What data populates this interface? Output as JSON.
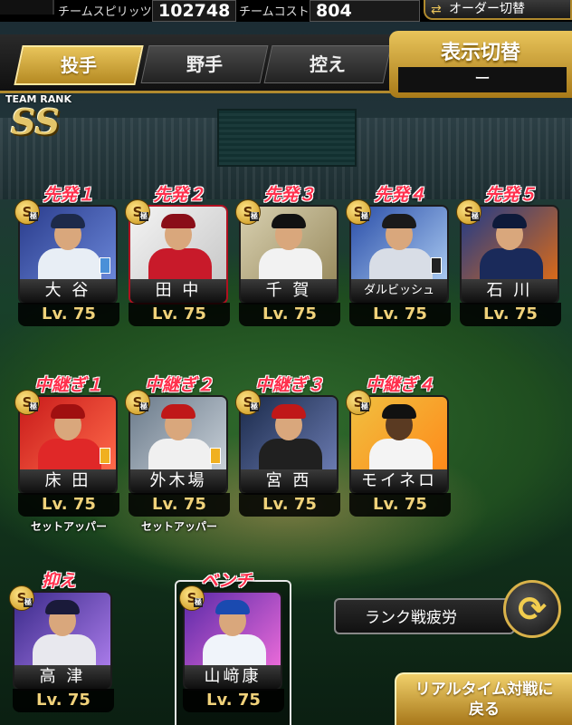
{
  "header": {
    "spirit_label": "チームスピリッツ",
    "spirit_value": "102748",
    "cost_label": "チームコスト",
    "cost_value": "804",
    "order_button": "オーダー切替"
  },
  "tabs": [
    {
      "label": "投手",
      "active": true
    },
    {
      "label": "野手",
      "active": false
    },
    {
      "label": "控え",
      "active": false
    }
  ],
  "display_toggle": {
    "title": "表示切替",
    "value": "ー"
  },
  "team_rank": {
    "label": "TEAM RANK",
    "value": "SS"
  },
  "starters": [
    {
      "role": "先発１",
      "name": "大 谷",
      "level": "Lv. 75",
      "badge": "S",
      "badge_sub": "極"
    },
    {
      "role": "先発２",
      "name": "田 中",
      "level": "Lv. 75",
      "badge": "S",
      "badge_sub": "極"
    },
    {
      "role": "先発３",
      "name": "千 賀",
      "level": "Lv. 75",
      "badge": "S",
      "badge_sub": "極"
    },
    {
      "role": "先発４",
      "name": "ダルビッシュ",
      "level": "Lv. 75",
      "badge": "S",
      "badge_sub": "極"
    },
    {
      "role": "先発５",
      "name": "石 川",
      "level": "Lv. 75",
      "badge": "S",
      "badge_sub": "極"
    }
  ],
  "relievers": [
    {
      "role": "中継ぎ１",
      "name": "床 田",
      "level": "Lv. 75",
      "badge": "S",
      "badge_sub": "極",
      "sub": "セットアッパー"
    },
    {
      "role": "中継ぎ２",
      "name": "外木場",
      "level": "Lv. 75",
      "badge": "S",
      "badge_sub": "極",
      "sub": "セットアッパー"
    },
    {
      "role": "中継ぎ３",
      "name": "宮 西",
      "level": "Lv. 75",
      "badge": "S",
      "badge_sub": "極",
      "sub": ""
    },
    {
      "role": "中継ぎ４",
      "name": "モイネロ",
      "level": "Lv. 75",
      "badge": "S",
      "badge_sub": "極",
      "sub": ""
    }
  ],
  "closer": {
    "role": "抑え",
    "name": "高 津",
    "level": "Lv. 75",
    "badge": "S",
    "badge_sub": "極"
  },
  "bench": {
    "role": "ベンチ",
    "name": "山﨑康",
    "level": "Lv. 75",
    "badge": "S",
    "badge_sub": "極"
  },
  "fatigue_button": "ランク戦疲労",
  "realtime_button_line1": "リアルタイム対戦に",
  "realtime_button_line2": "戻る",
  "colors": {
    "gold": "#d9b24a",
    "role_red": "#ff2f4c",
    "level_gold": "#f0d27a"
  }
}
